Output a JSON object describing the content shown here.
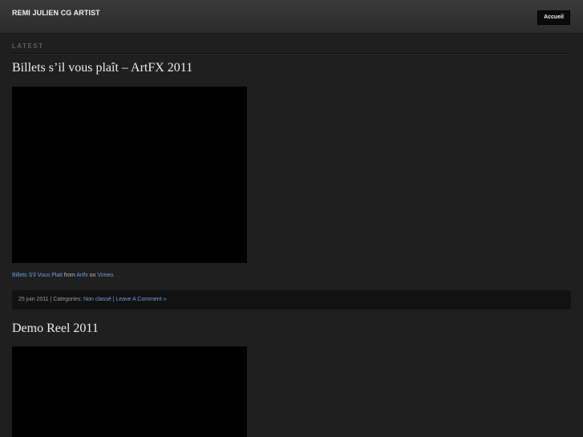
{
  "header": {
    "site_title": "REMI JULIEN CG ARTIST",
    "nav_button": "Accueil"
  },
  "section": {
    "label": "LATEST"
  },
  "posts": [
    {
      "title": "Billets s’il vous plaît – ArtFX 2011",
      "caption": {
        "link1": "Billets S'il Vous Plait",
        "text1": " from ",
        "link2": "Artfx",
        "text2": " on ",
        "link3": "Vimeo",
        "text3": "."
      },
      "meta": {
        "date": "25 juin 2011",
        "sep1": " | Categories: ",
        "category": "Non classé",
        "sep2": " | ",
        "comment": "Leave A Comment »"
      }
    },
    {
      "title": "Demo Reel 2011"
    }
  ],
  "colors": {
    "background": "#1f1f1f",
    "header": "#333333",
    "link": "#6f9fd8",
    "video": "#000000"
  }
}
